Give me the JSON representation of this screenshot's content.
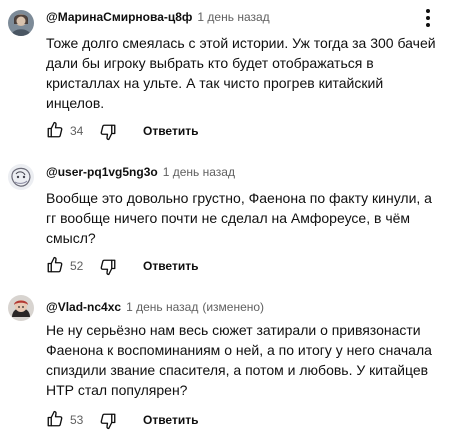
{
  "comments": [
    {
      "author": "@МаринаСмирнова-ц8ф",
      "date": "1 день назад",
      "edited": "",
      "lines": [
        "Тоже долго смеялась с этой истории. Уж тогда за 300 бачей",
        "дали бы игроку выбрать кто будет отображаться в",
        "кристаллах на ульте. А так чисто прогрев китайский",
        "инцелов."
      ],
      "likes": "34",
      "reply_label": "Ответить",
      "avatar_color": "#8a9aa8"
    },
    {
      "author": "@user-pq1vg5ng3o",
      "date": "1 день назад",
      "edited": "",
      "lines": [
        "Вообще это довольно грустно, Фаенона по факту кинули, а",
        "гг вообще ничего почти не сделал на Амфореусе, в чём",
        "смысл?"
      ],
      "likes": "52",
      "reply_label": "Ответить",
      "avatar_color": "#e4e4e8"
    },
    {
      "author": "@Vlad-nc4xc",
      "date": "1 день назад",
      "edited": "(изменено)",
      "lines": [
        "Не ну серьёзно нам весь сюжет затирали о привязонасти",
        "Фаенона к воспоминаниям о ней, а по итогу у него сначала",
        "спиздили звание спасителя, а потом и любовь. У китайцев",
        "НТР стал популярен?"
      ],
      "likes": "53",
      "reply_label": "Ответить",
      "avatar_color": "#b0403c"
    }
  ],
  "icons": {
    "like": "thumb-up-icon",
    "dislike": "thumb-down-icon",
    "menu": "more-vert-icon"
  }
}
